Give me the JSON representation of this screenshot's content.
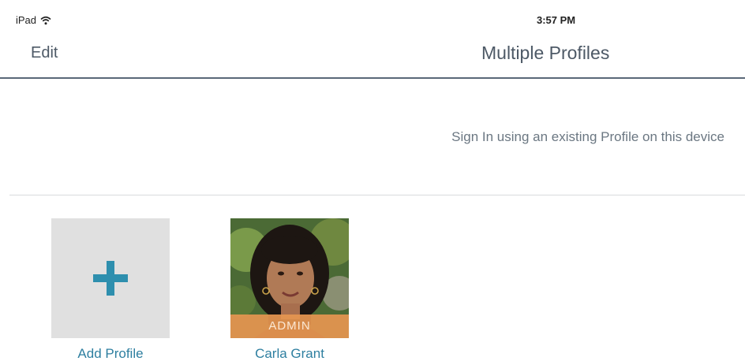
{
  "status_bar": {
    "device": "iPad",
    "wifi_icon": "wifi-icon",
    "time": "3:57 PM"
  },
  "nav": {
    "edit_label": "Edit",
    "title": "Multiple Profiles"
  },
  "info": {
    "text": "Sign In using an existing Profile on this device"
  },
  "profiles": [
    {
      "type": "add",
      "icon": "plus-icon",
      "label": "Add Profile"
    },
    {
      "type": "user",
      "name": "Carla Grant",
      "badge": "ADMIN"
    }
  ],
  "colors": {
    "accent": "#2e8fae",
    "badge": "#e69650",
    "tile_bg": "#e0e0e0",
    "nav_border": "#5a6878"
  }
}
